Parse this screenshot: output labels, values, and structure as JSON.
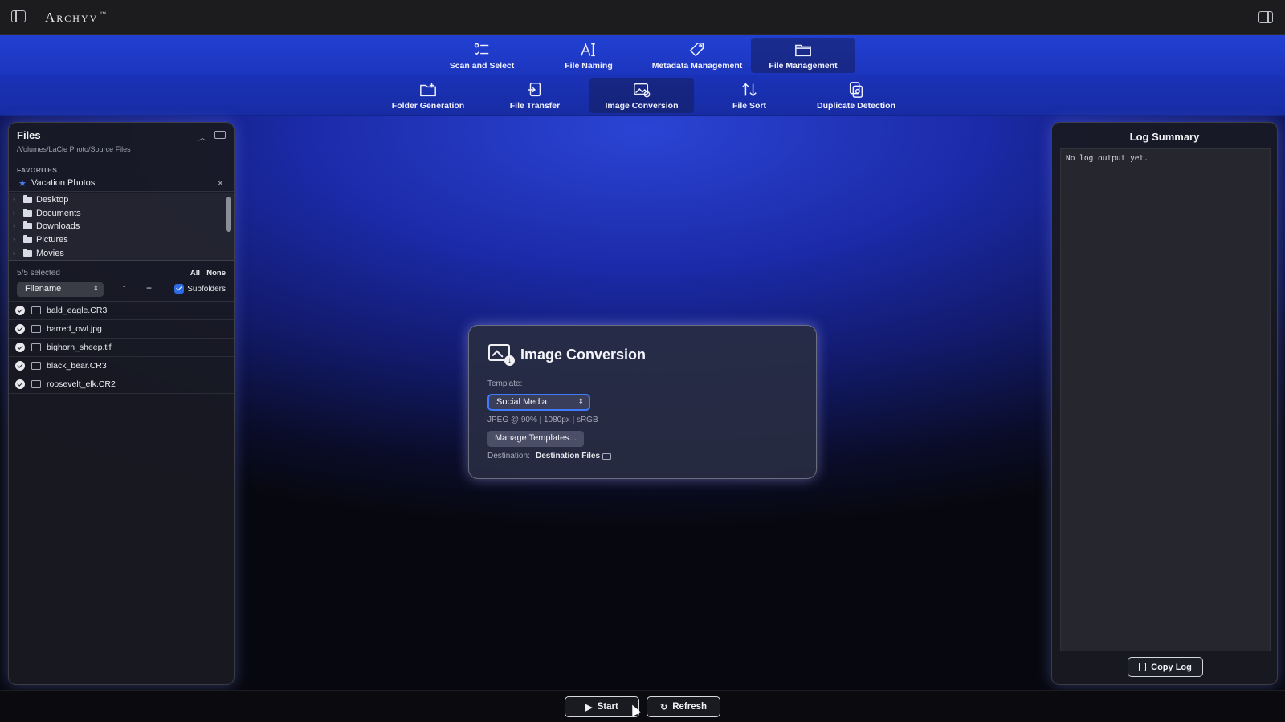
{
  "app": {
    "name": "Archyv",
    "trademark": "™"
  },
  "main_tabs": [
    {
      "label": "Scan and Select",
      "icon": "scan-select-icon"
    },
    {
      "label": "File Naming",
      "icon": "text-cursor-icon"
    },
    {
      "label": "Metadata Management",
      "icon": "tag-icon"
    },
    {
      "label": "File Management",
      "icon": "folder-icon",
      "active": true
    }
  ],
  "sub_tabs": [
    {
      "label": "Folder Generation",
      "icon": "folder-plus-icon"
    },
    {
      "label": "File Transfer",
      "icon": "file-transfer-icon"
    },
    {
      "label": "Image Conversion",
      "icon": "image-convert-icon",
      "active": true
    },
    {
      "label": "File Sort",
      "icon": "sort-arrows-icon"
    },
    {
      "label": "Duplicate Detection",
      "icon": "duplicate-icon"
    }
  ],
  "files": {
    "title": "Files",
    "path": "/Volumes/LaCie Photo/Source Files",
    "favorites_label": "FAVORITES",
    "favorite": "Vacation Photos",
    "tree": [
      "Desktop",
      "Documents",
      "Downloads",
      "Pictures",
      "Movies"
    ],
    "selected_count": "5/5 selected",
    "all_label": "All",
    "none_label": "None",
    "sort_by": "Filename",
    "subfolders_label": "Subfolders",
    "items": [
      "bald_eagle.CR3",
      "barred_owl.jpg",
      "bighorn_sheep.tif",
      "black_bear.CR3",
      "roosevelt_elk.CR2"
    ]
  },
  "conversion": {
    "title": "Image Conversion",
    "template_label": "Template:",
    "template_value": "Social Media",
    "template_desc": "JPEG @ 90% | 1080px | sRGB",
    "manage_label": "Manage Templates...",
    "destination_label": "Destination:",
    "destination_value": "Destination Files"
  },
  "log": {
    "title": "Log Summary",
    "output": "No log output yet.",
    "copy_label": "Copy Log"
  },
  "actions": {
    "start_label": "Start",
    "refresh_label": "Refresh"
  },
  "colors": {
    "accent": "#3e7bff",
    "toolbar": "#2140d2"
  }
}
